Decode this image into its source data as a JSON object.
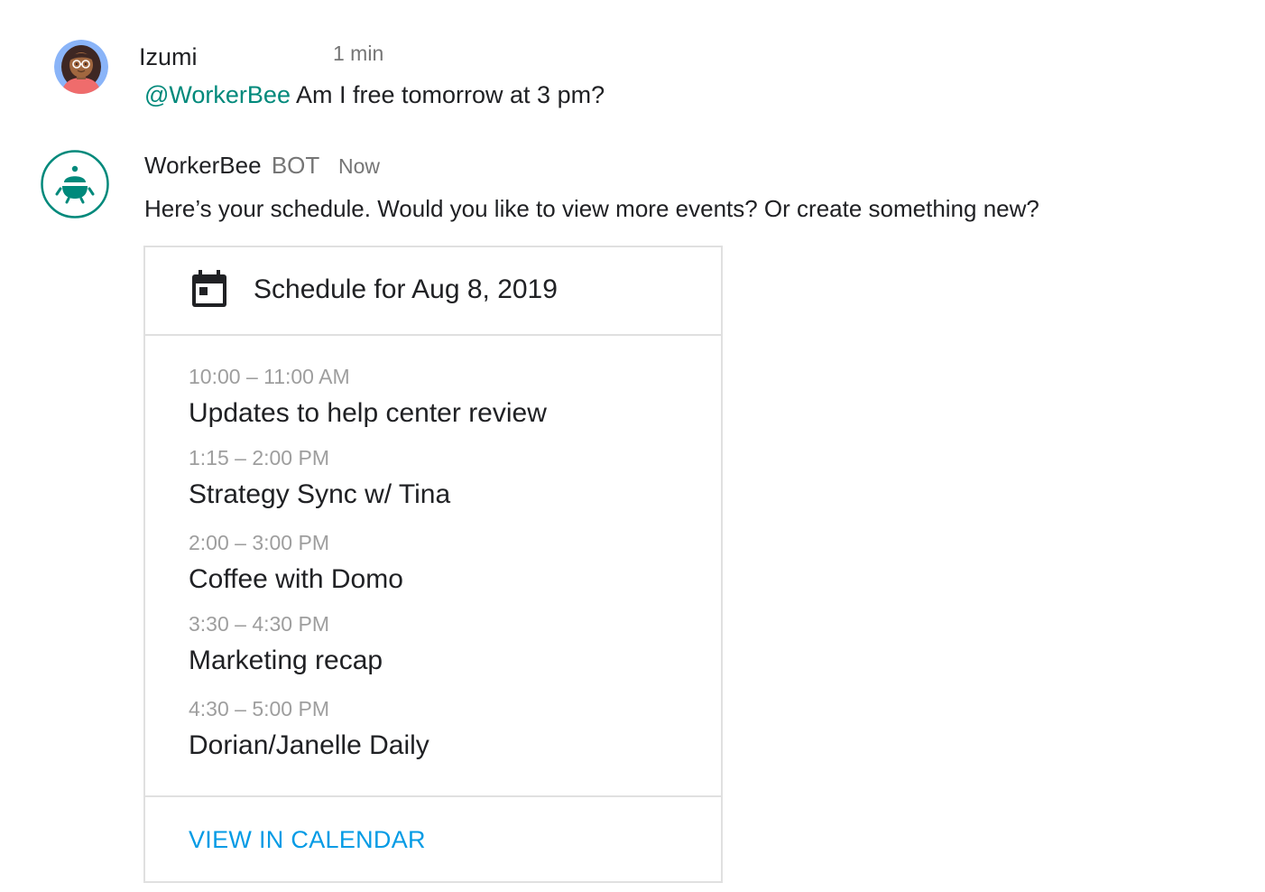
{
  "messages": {
    "user": {
      "name": "Izumi",
      "time": "1 min",
      "mention": "@WorkerBee",
      "text": " Am I free tomorrow at 3 pm?"
    },
    "bot": {
      "name": "WorkerBee",
      "badge": "BOT",
      "time": "Now",
      "text": "Here’s your schedule. Would you like to view more events? Or create something new?"
    }
  },
  "card": {
    "icon": "calendar-icon",
    "title": "Schedule for Aug 8, 2019",
    "events": [
      {
        "time": "10:00 – 11:00 AM",
        "title": "Updates to help center review"
      },
      {
        "time": "1:15 – 2:00 PM",
        "title": "Strategy Sync w/ Tina"
      },
      {
        "time": "2:00 – 3:00 PM",
        "title": "Coffee with Domo"
      },
      {
        "time": "3:30 – 4:30 PM",
        "title": "Marketing recap"
      },
      {
        "time": "4:30 – 5:00 PM",
        "title": "Dorian/Janelle Daily"
      }
    ],
    "action_label": "VIEW IN CALENDAR"
  },
  "colors": {
    "accent_mention": "#00897b",
    "bot_avatar": "#00897b",
    "link": "#039be5",
    "border": "#e0e0e0",
    "muted_text": "#757575"
  }
}
